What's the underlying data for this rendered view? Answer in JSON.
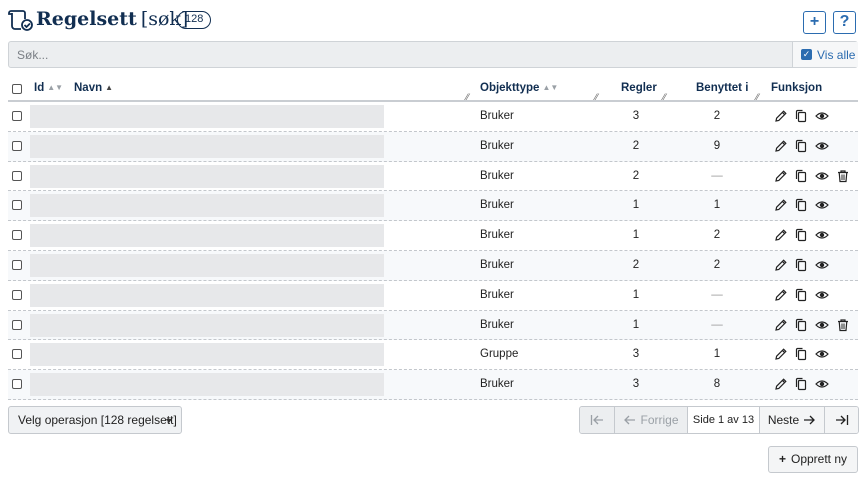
{
  "header": {
    "title": "Regelsett",
    "subtitle": "[søk]",
    "count": "128",
    "add_label": "+",
    "help_label": "?"
  },
  "search": {
    "placeholder": "Søk...",
    "value": "",
    "show_all_label": "Vis alle",
    "show_all_checked": true
  },
  "table": {
    "columns": {
      "id": "Id",
      "name": "Navn",
      "object_type": "Objekttype",
      "rules": "Regler",
      "used_in": "Benyttet i",
      "functions": "Funksjon"
    },
    "sort": {
      "id": "none",
      "name": "asc",
      "object_type": "none"
    },
    "rows": [
      {
        "type": "Bruker",
        "rules": "3",
        "used": "2",
        "delete": false
      },
      {
        "type": "Bruker",
        "rules": "2",
        "used": "9",
        "delete": false
      },
      {
        "type": "Bruker",
        "rules": "2",
        "used": "—",
        "delete": true
      },
      {
        "type": "Bruker",
        "rules": "1",
        "used": "1",
        "delete": false
      },
      {
        "type": "Bruker",
        "rules": "1",
        "used": "2",
        "delete": false
      },
      {
        "type": "Bruker",
        "rules": "2",
        "used": "2",
        "delete": false
      },
      {
        "type": "Bruker",
        "rules": "1",
        "used": "—",
        "delete": false
      },
      {
        "type": "Bruker",
        "rules": "1",
        "used": "—",
        "delete": true
      },
      {
        "type": "Gruppe",
        "rules": "3",
        "used": "1",
        "delete": false
      },
      {
        "type": "Bruker",
        "rules": "3",
        "used": "8",
        "delete": false
      }
    ]
  },
  "footer": {
    "operation_label": "Velg operasjon [128 regelsett]",
    "pager": {
      "first_icon": "first-page-icon",
      "prev_label": "Forrige",
      "page_info": "Side 1 av 13",
      "next_label": "Neste",
      "last_icon": "last-page-icon"
    },
    "create_label": "Opprett ny"
  },
  "colors": {
    "title": "#112e51",
    "accent": "#2b6cb0",
    "name_placeholder": "#e7e8ea"
  }
}
